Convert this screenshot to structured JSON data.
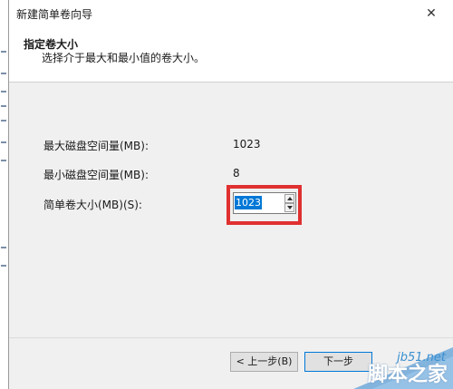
{
  "window": {
    "title": "新建简单卷向导",
    "close_glyph": "✕"
  },
  "header": {
    "title": "指定卷大小",
    "subtitle": "选择介于最大和最小值的卷大小。"
  },
  "fields": {
    "max_label": "最大磁盘空间量(MB):",
    "max_value": "1023",
    "min_label": "最小磁盘空间量(MB):",
    "min_value": "8",
    "size_label": "简单卷大小(MB)(S):",
    "size_value": "1023"
  },
  "buttons": {
    "back": "< 上一步(B)",
    "next": "下一步"
  },
  "watermark": {
    "site": "jb51.net",
    "name": "脚本之家"
  },
  "colors": {
    "highlight": "#e03030",
    "selection": "#0078d7"
  }
}
